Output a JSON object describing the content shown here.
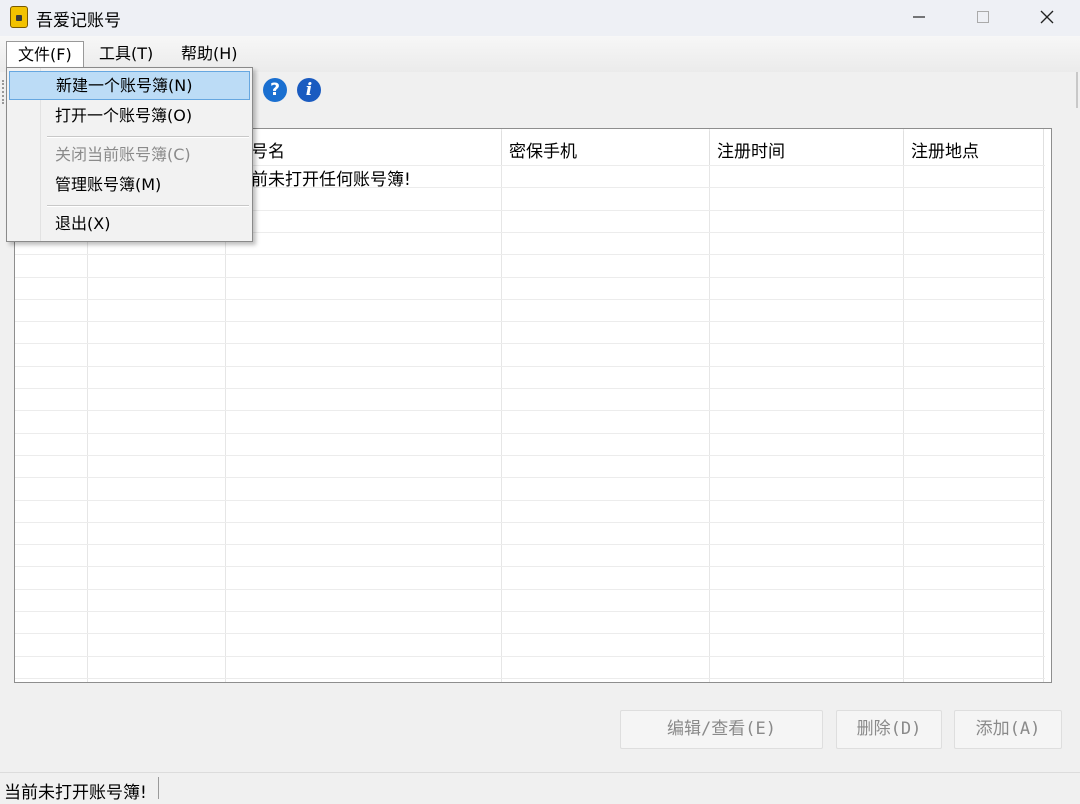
{
  "window": {
    "title": "吾爱记账号"
  },
  "menubar": {
    "items": [
      {
        "label": "文件(F)"
      },
      {
        "label": "工具(T)"
      },
      {
        "label": "帮助(H)"
      }
    ]
  },
  "file_menu": {
    "items": [
      {
        "label": "新建一个账号簿(N)",
        "state": "highlighted"
      },
      {
        "label": "打开一个账号簿(O)",
        "state": "enabled"
      },
      {
        "label": "关闭当前账号簿(C)",
        "state": "disabled"
      },
      {
        "label": "管理账号簿(M)",
        "state": "enabled"
      },
      {
        "label": "退出(X)",
        "state": "enabled"
      }
    ]
  },
  "toolbar": {
    "help_icon": "help-icon",
    "info_icon": "info-icon"
  },
  "table": {
    "columns": [
      {
        "label": ""
      },
      {
        "label": ""
      },
      {
        "label": "号名"
      },
      {
        "label": "密保手机"
      },
      {
        "label": "注册时间"
      },
      {
        "label": "注册地点"
      }
    ],
    "message": "前未打开任何账号簿!"
  },
  "buttons": {
    "edit": "编辑/查看(E)",
    "delete": "删除(D)",
    "add": "添加(A)"
  },
  "status": {
    "text": "当前未打开账号簿!"
  },
  "colors": {
    "highlight_bg": "#bcdcf6",
    "highlight_border": "#66a7e0",
    "disabled_text": "#8b8b8b"
  }
}
